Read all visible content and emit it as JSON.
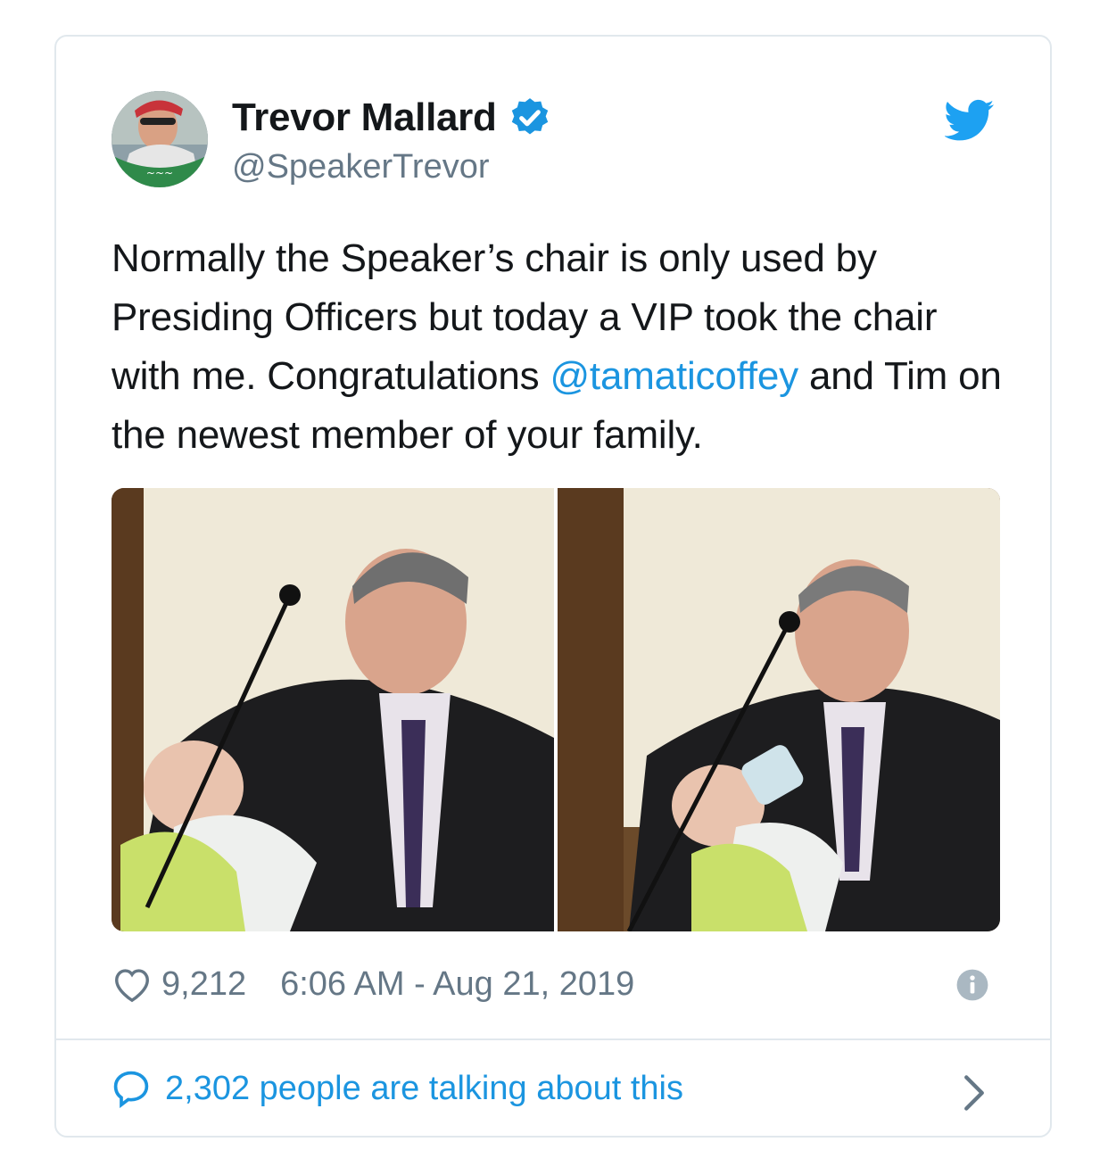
{
  "tweet": {
    "author_name": "Trevor Mallard",
    "author_handle": "@SpeakerTrevor",
    "text_before_mention": "Normally the Speaker’s chair is only used by Presiding Officers but today a VIP took the chair with me. Congratulations ",
    "mention": "@tamaticoffey",
    "text_after_mention": " and Tim on the newest member of your family.",
    "likes": "9,212",
    "timestamp": "6:06 AM - Aug 21, 2019",
    "talking_text": "2,302 people are talking about this"
  },
  "icons": {
    "verified": "verified-badge-icon",
    "brand": "twitter-bird-icon",
    "like": "heart-icon",
    "info": "info-icon",
    "reply": "speech-bubble-icon",
    "more": "chevron-right-icon"
  },
  "colors": {
    "accent": "#1b95e0",
    "text": "#14171a",
    "muted": "#657786",
    "border": "#e1e8ed"
  }
}
